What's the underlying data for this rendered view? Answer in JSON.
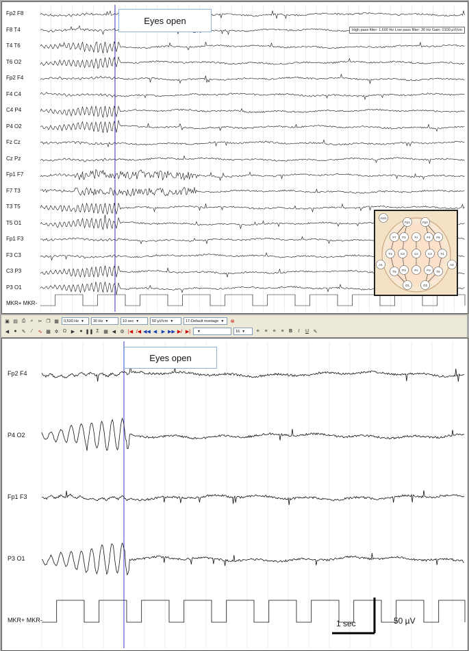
{
  "top_panel": {
    "channels": [
      "Fp2  F8",
      "F8  T4",
      "T4  T6",
      "T6  O2",
      "Fp2  F4",
      "F4  C4",
      "C4  P4",
      "P4  O2",
      "Fz  Cz",
      "Cz  Pz",
      "Fp1  F7",
      "F7  T3",
      "T3  T5",
      "T5  O1",
      "Fp1  F3",
      "F3  C3",
      "C3  P3",
      "P3  O1",
      "MKR+  MKR-"
    ],
    "annotation": "Eyes open",
    "filter_info": "High pass filter: 1,600 Hz    Low pass filter: 30 Hz    Gain: 0100 µV/cm",
    "electrodes": [
      "AVG",
      "Fp2",
      "Fp1",
      "F8",
      "F4",
      "Fz",
      "F3",
      "F7",
      "T4",
      "C4",
      "Cz",
      "C3",
      "T3",
      "A2",
      "A1",
      "T6",
      "P4",
      "Pz",
      "P3",
      "T5",
      "O2",
      "O1"
    ]
  },
  "toolbar": {
    "high_pass": "0,530 Hz",
    "low_pass": "30 Hz",
    "timebase": "10 sec",
    "gain": "50 µV/cm",
    "montage": "17-Default montage",
    "font_size": "16",
    "bold": "B",
    "italic": "I",
    "underline": "U"
  },
  "bottom_panel": {
    "channels": [
      "Fp2  F4",
      "P4  O2",
      "Fp1  F3",
      "P3  O1",
      "MKR+  MKR-"
    ],
    "annotation": "Eyes open",
    "scale_time": "1 sec",
    "scale_amp": "50 µV"
  }
}
